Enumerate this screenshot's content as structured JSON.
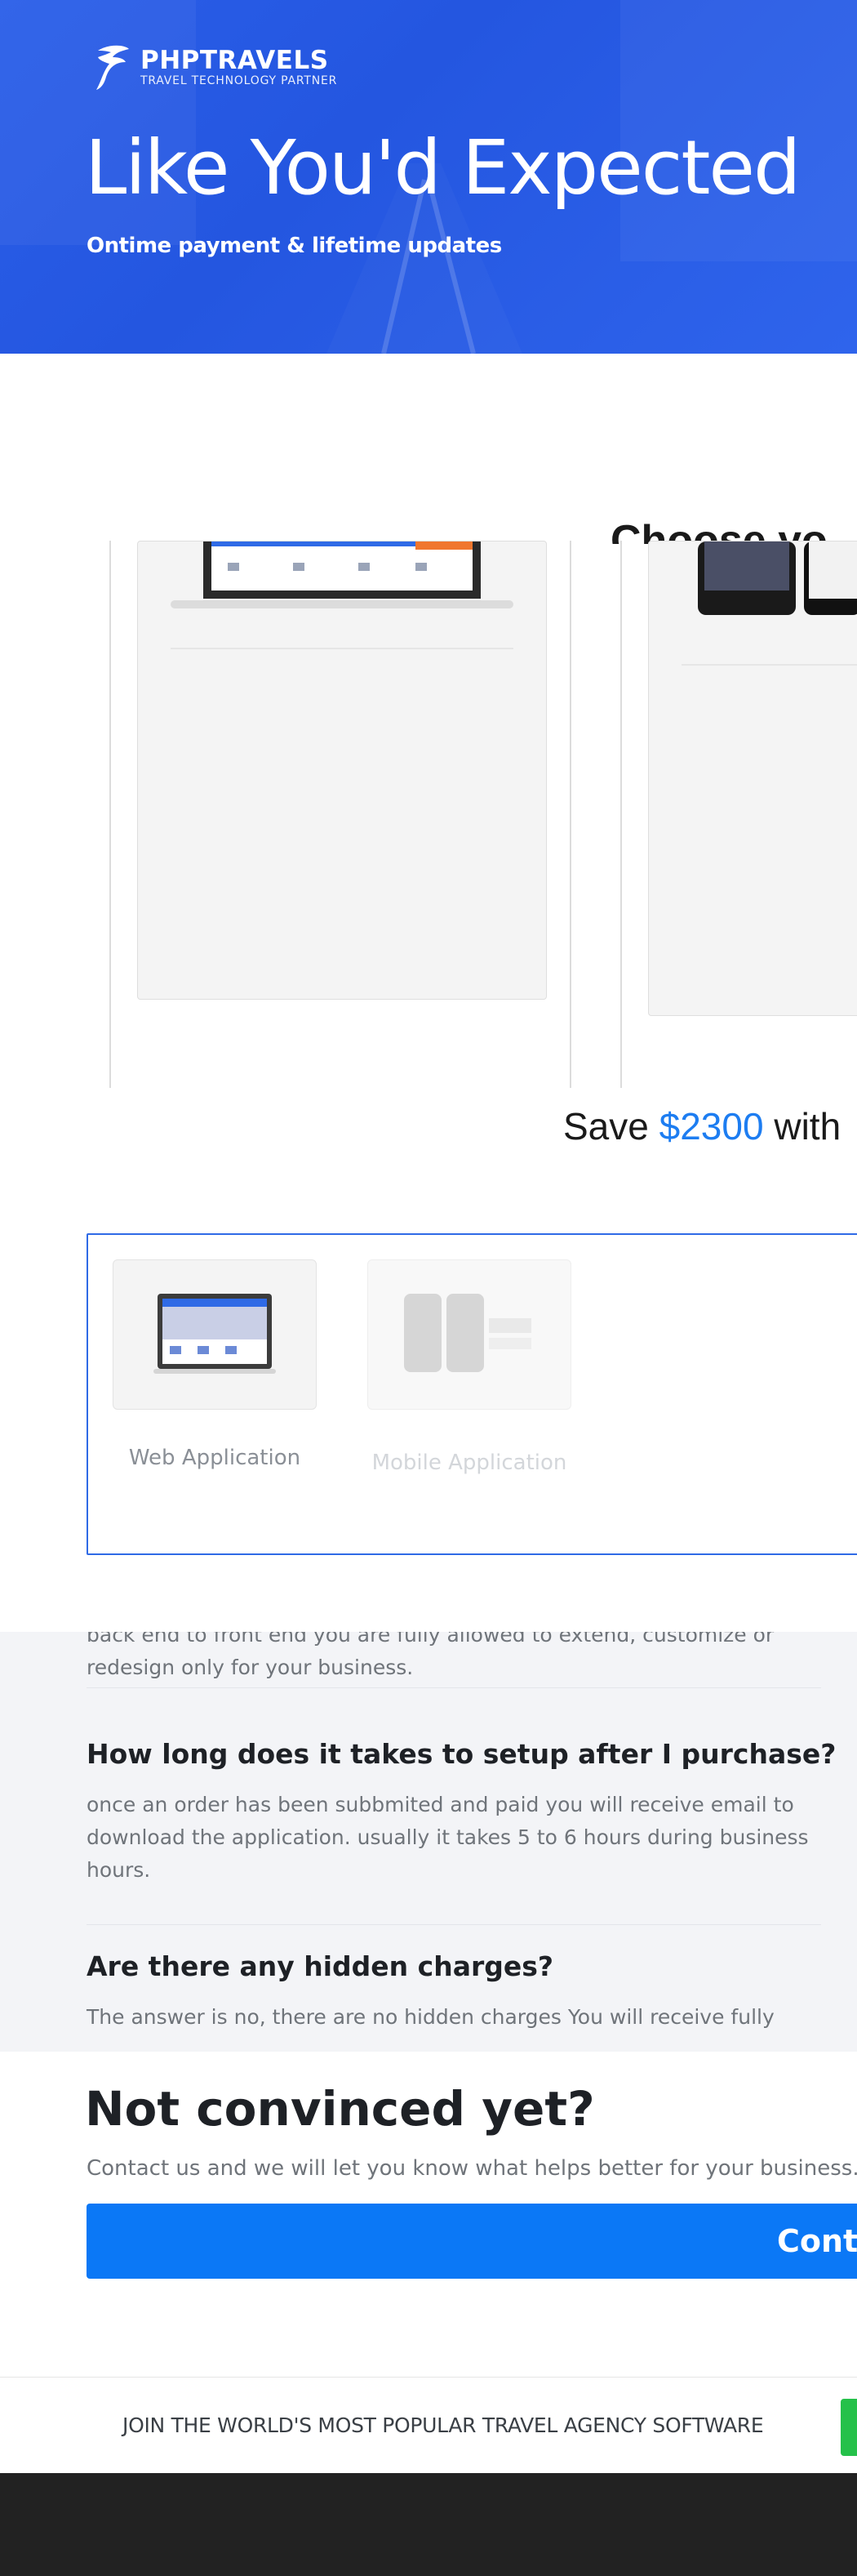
{
  "brand": {
    "name": "PHPTRAVELS",
    "tagline": "TRAVEL TECHNOLOGY PARTNER"
  },
  "hero": {
    "title": "Like You'd Expected",
    "subtitle": "Ontime payment & lifetime updates"
  },
  "products": {
    "title": "Choose yo"
  },
  "savings": {
    "prefix": "Save ",
    "amount": "$2300",
    "suffix": " with"
  },
  "app_selector": {
    "options": [
      {
        "label": "Web Application",
        "selected": true
      },
      {
        "label": "Mobile Application",
        "selected": false
      }
    ]
  },
  "faq": {
    "clipped_answer_lines": [
      "back end to front end you are fully allowed to extend, customize or",
      "redesign only for your business."
    ],
    "items": [
      {
        "question": "How long does it takes to setup after I purchase?",
        "answer": "once an order has been subbmited and paid you will receive email to download the application. usually it takes 5 to 6 hours during business hours."
      },
      {
        "question": "Are there any hidden charges?",
        "answer": "The answer is no, there are no hidden charges You will receive fully"
      }
    ]
  },
  "not_convinced": {
    "title": "Not convinced yet?",
    "subtitle": "Contact us and we will let you know what helps better for your business.",
    "button_label": "Conta"
  },
  "join_bar": {
    "text": "JOIN THE WORLD'S MOST POPULAR TRAVEL AGENCY SOFTWARE"
  },
  "colors": {
    "hero": "#2a5ee8",
    "accent": "#1d7df1",
    "button": "#0b78f6",
    "join_button": "#25c14a",
    "footer": "#222222"
  }
}
